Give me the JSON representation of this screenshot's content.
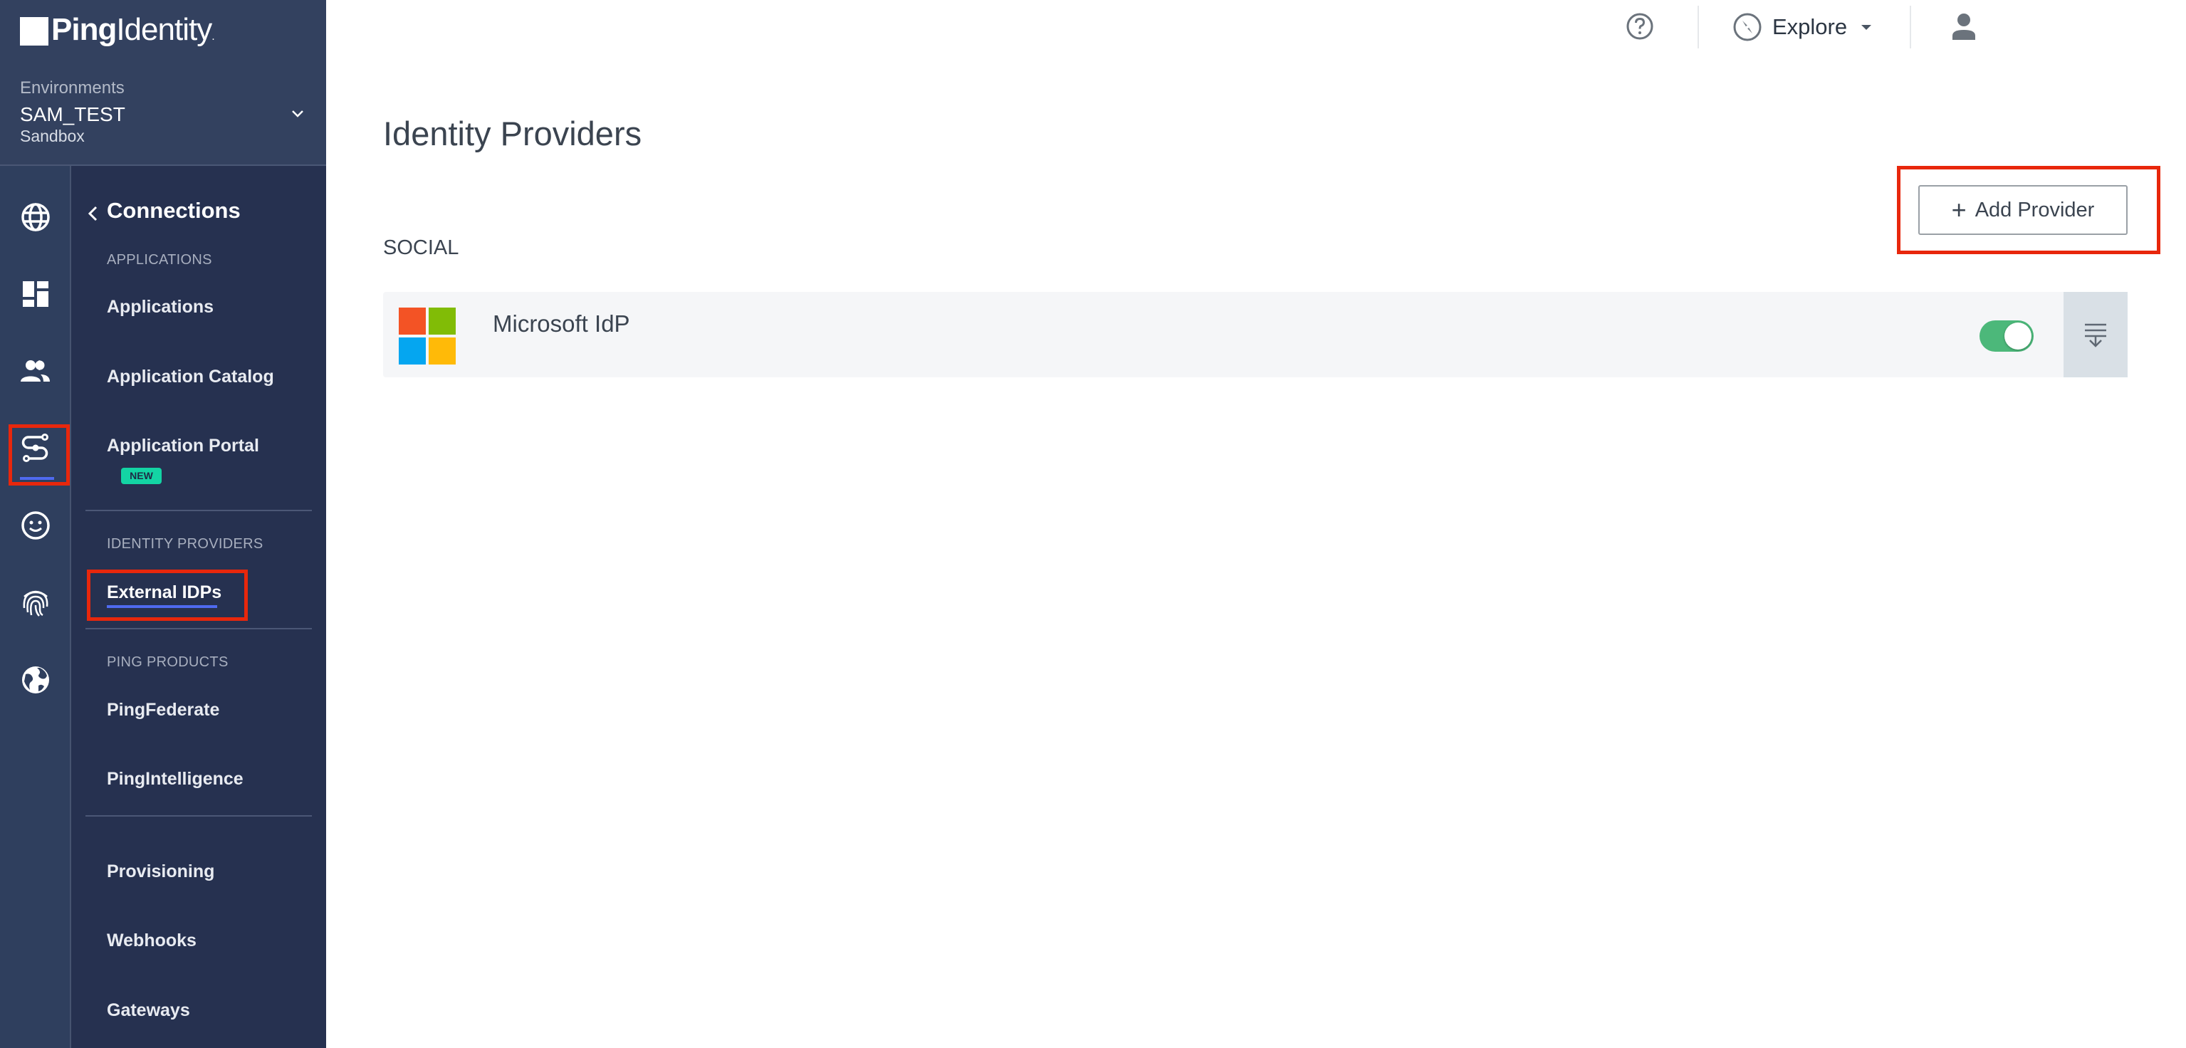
{
  "brand": {
    "logo_bold": "Ping",
    "logo_light": "Identity",
    "logo_mark": "."
  },
  "environment": {
    "label": "Environments",
    "name": "SAM_TEST",
    "type": "Sandbox"
  },
  "rail": {
    "icons": [
      {
        "name": "globe-icon",
        "label": "Environment"
      },
      {
        "name": "dashboard-icon",
        "label": "Dashboard"
      },
      {
        "name": "users-icon",
        "label": "Identities"
      },
      {
        "name": "connections-icon",
        "label": "Connections",
        "active": true
      },
      {
        "name": "experiences-icon",
        "label": "Experiences"
      },
      {
        "name": "fingerprint-icon",
        "label": "Authentication"
      },
      {
        "name": "earth-icon",
        "label": "Settings"
      }
    ]
  },
  "subnav": {
    "title": "Connections",
    "sections": {
      "applications": "APPLICATIONS",
      "identity_providers": "IDENTITY PROVIDERS",
      "ping_products": "PING PRODUCTS"
    },
    "items": {
      "applications": "Applications",
      "application_catalog": "Application Catalog",
      "application_portal": "Application Portal",
      "external_idps": "External IDPs",
      "pingfederate": "PingFederate",
      "pingintelligence": "PingIntelligence",
      "provisioning": "Provisioning",
      "webhooks": "Webhooks",
      "gateways": "Gateways"
    },
    "new_badge": "NEW",
    "active_item": "External IDPs"
  },
  "topbar": {
    "explore_label": "Explore"
  },
  "main": {
    "title": "Identity Providers",
    "add_button_label": "Add Provider",
    "add_button_icon": "+",
    "section": "SOCIAL",
    "providers": [
      {
        "name": "Microsoft IdP",
        "enabled": true,
        "logo": "microsoft-logo"
      }
    ]
  },
  "colors": {
    "accent": "#4f6af0",
    "toggle_on": "#4cb87a",
    "highlight_box": "#e8270c",
    "new_badge": "#13d4a4",
    "ms_red": "#f35325",
    "ms_green": "#81bc06",
    "ms_blue": "#05a6f0",
    "ms_yellow": "#ffba08"
  }
}
